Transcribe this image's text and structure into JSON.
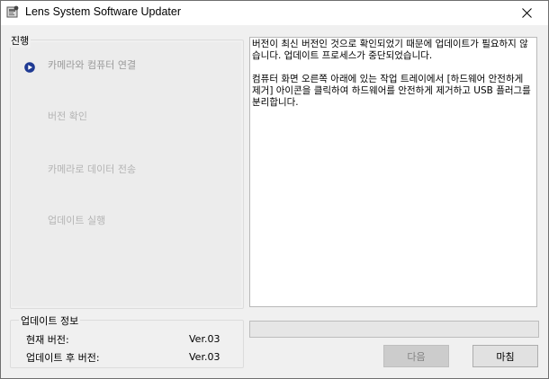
{
  "window": {
    "title": "Lens System Software Updater"
  },
  "progress": {
    "legend": "진행",
    "steps": [
      {
        "label": "카메라와 컴퓨터 연결",
        "state": "active"
      },
      {
        "label": "버전 확인",
        "state": "inactive"
      },
      {
        "label": "카메라로 데이터 전송",
        "state": "inactive"
      },
      {
        "label": "업데이트 실행",
        "state": "inactive"
      }
    ]
  },
  "message": {
    "text": "버전이 최신 버전인 것으로 확인되었기 때문에 업데이트가 필요하지 않습니다. 업데이트 프로세스가 중단되었습니다.\n\n컴퓨터 화면 오른쪽 아래에 있는 작업 트레이에서 [하드웨어 안전하게 제거] 아이콘을 클릭하여 하드웨어를 안전하게 제거하고 USB 플러그를 분리합니다."
  },
  "update_info": {
    "legend": "업데이트 정보",
    "current_label": "현재 버전:",
    "current_value": "Ver.03",
    "after_label": "업데이트 후 버전:",
    "after_value": "Ver.03"
  },
  "update_progress": {
    "fraction": 0
  },
  "buttons": {
    "next_label": "다음",
    "finish_label": "마침"
  },
  "colors": {
    "active_step_icon": "#1f3a93",
    "progress_fill": "#06b025"
  }
}
